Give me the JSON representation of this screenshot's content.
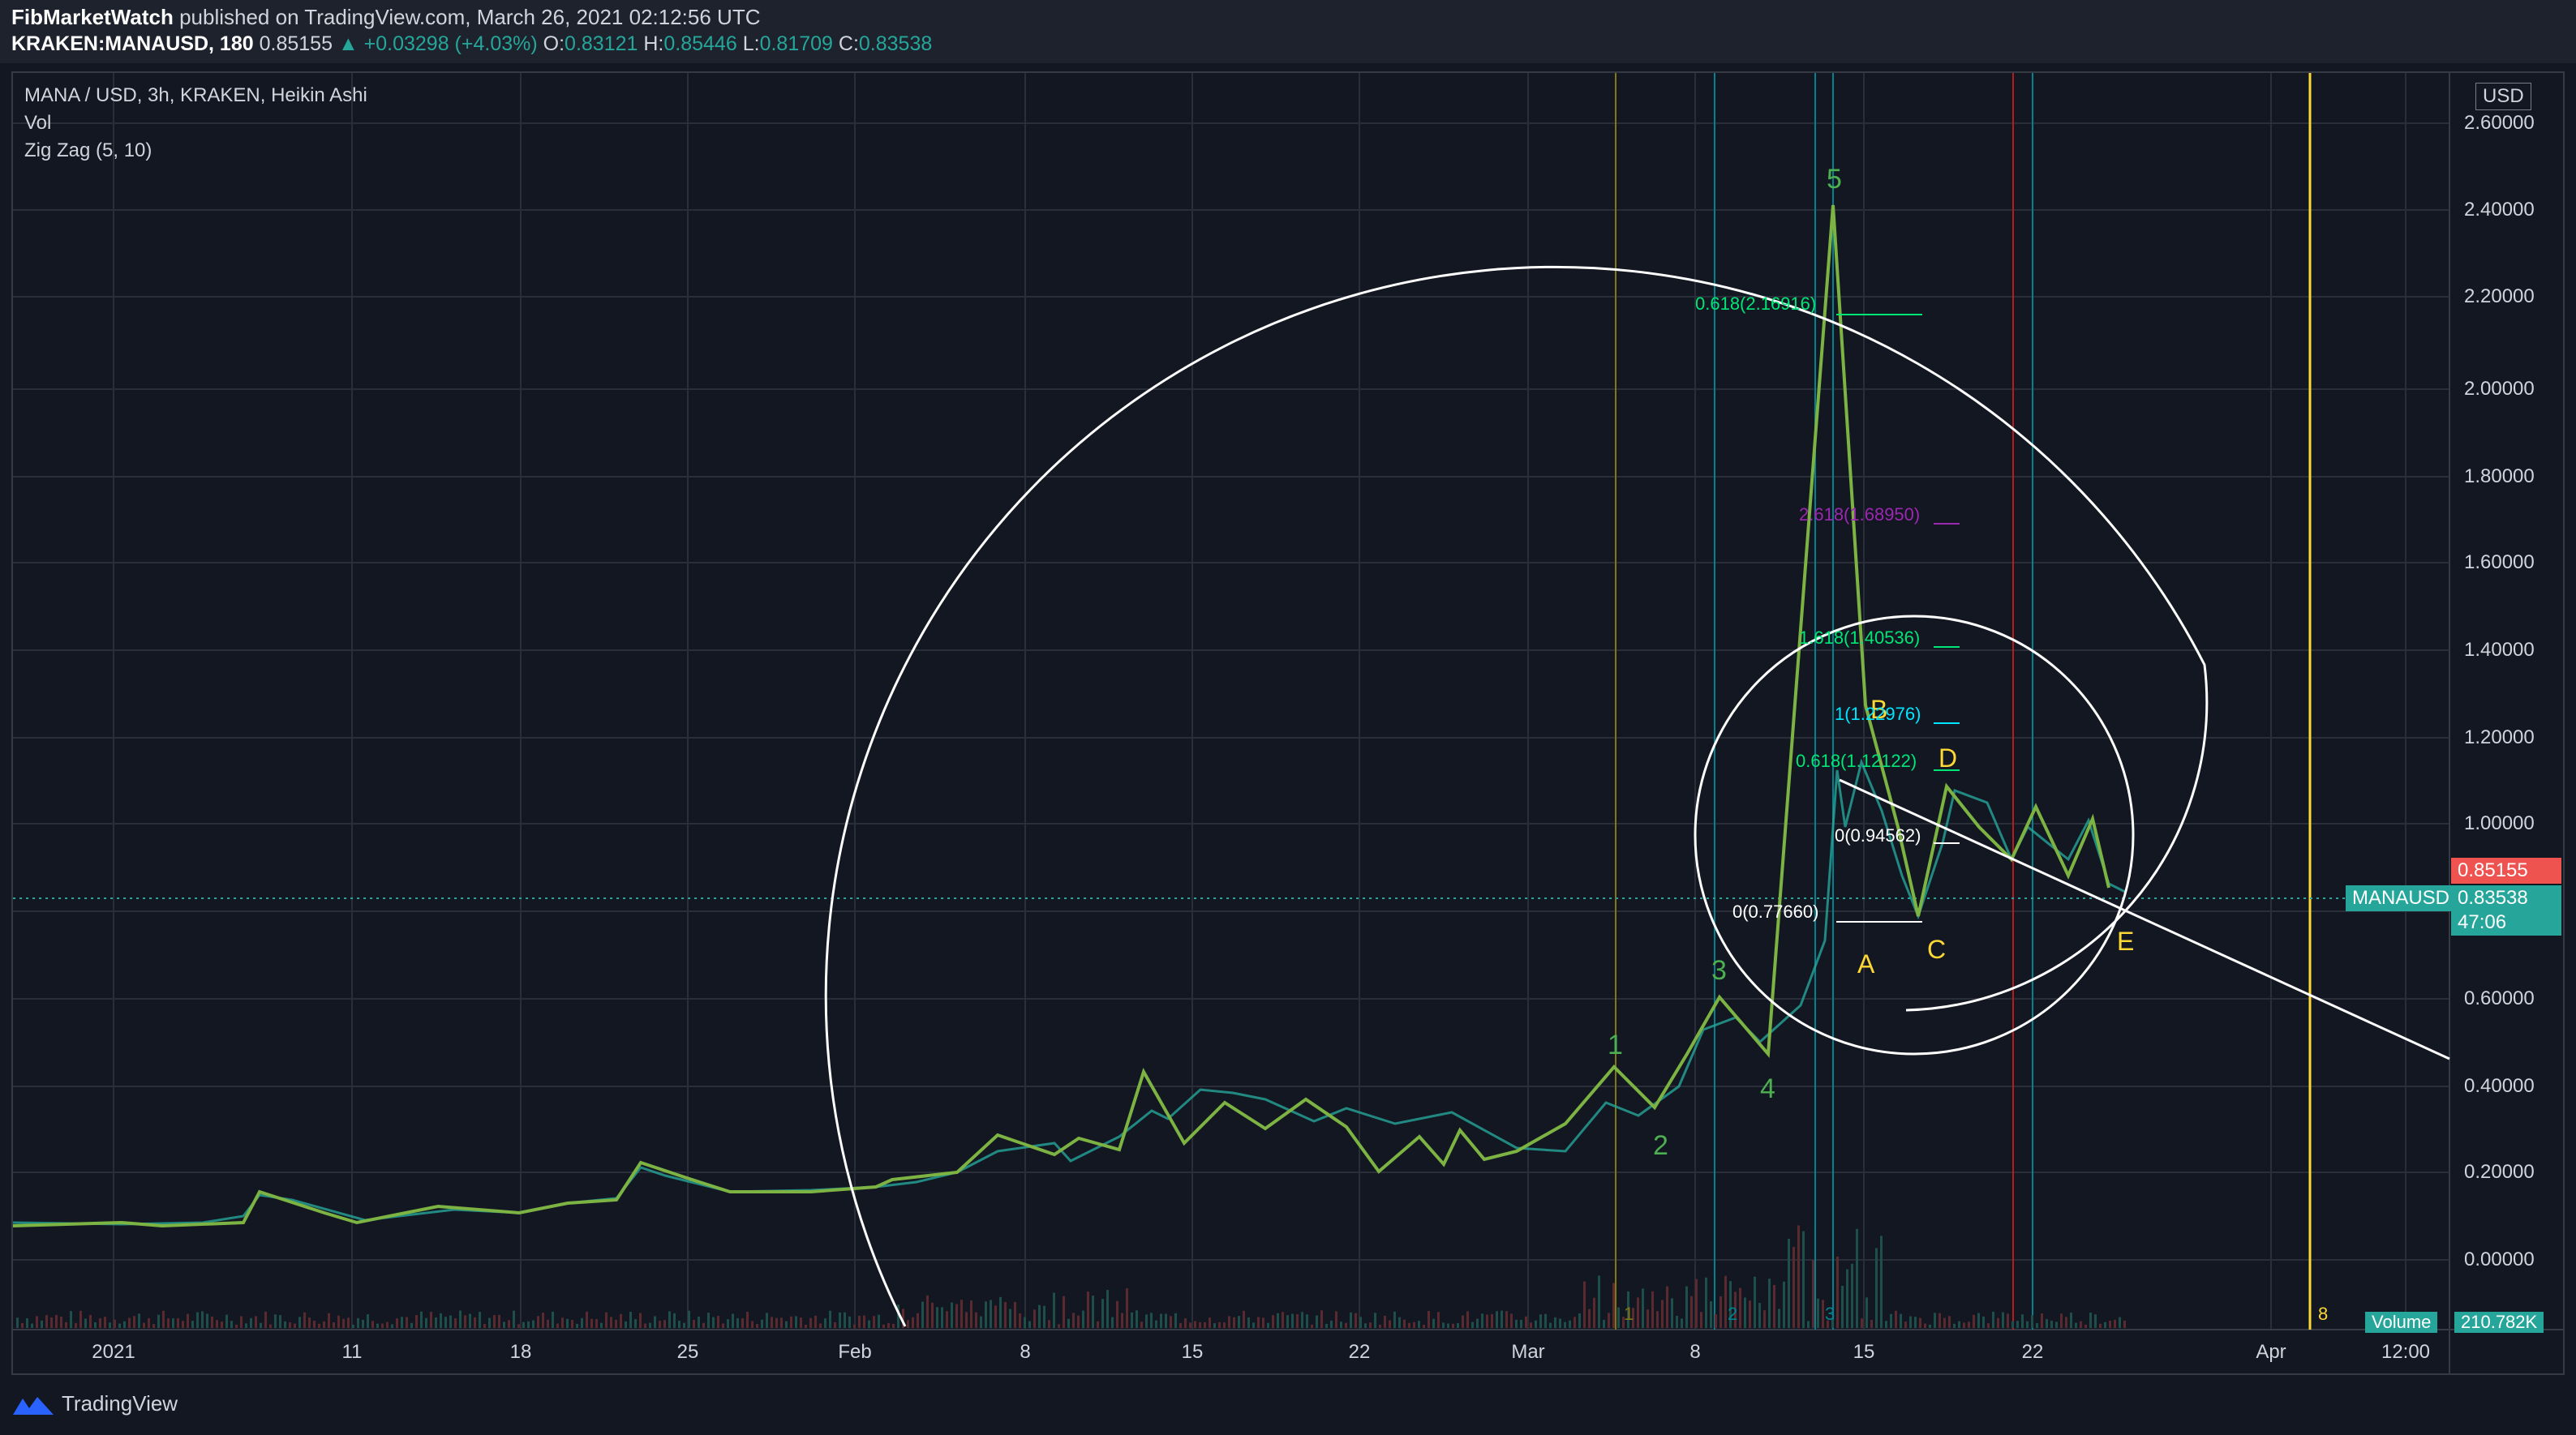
{
  "header": {
    "author": "FibMarketWatch",
    "published_text": "published on TradingView.com, March 26, 2021 02:12:56 UTC"
  },
  "ohlc": {
    "symbol": "KRAKEN:MANAUSD, 180",
    "last": "0.85155",
    "change": "▲ +0.03298 (+4.03%)",
    "o_label": "O:",
    "o": "0.83121",
    "h_label": "H:",
    "h": "0.85446",
    "l_label": "L:",
    "l": "0.81709",
    "c_label": "C:",
    "c": "0.83538"
  },
  "legend": {
    "title": "MANA / USD, 3h, KRAKEN, Heikin Ashi",
    "vol": "Vol",
    "zigzag": "Zig Zag (5, 10)"
  },
  "price_axis": {
    "currency": "USD",
    "labels": [
      "2.60000",
      "2.40000",
      "2.20000",
      "2.00000",
      "1.80000",
      "1.60000",
      "1.40000",
      "1.20000",
      "1.00000",
      "0.80000",
      "0.60000",
      "0.40000",
      "0.20000",
      "0.00000"
    ],
    "last_price_tag": "0.85155",
    "current_tag": "0.83538",
    "countdown": "47:06",
    "symbol_tag": "MANAUSD",
    "volume_tag_label": "Volume",
    "volume_tag_value": "210.782K"
  },
  "time_axis": {
    "labels": [
      "2021",
      "11",
      "18",
      "25",
      "Feb",
      "8",
      "15",
      "22",
      "Mar",
      "8",
      "15",
      "22",
      "Apr",
      "12:00"
    ]
  },
  "annotations": {
    "waves": [
      "1",
      "2",
      "3",
      "4",
      "5"
    ],
    "corrective": [
      "A",
      "B",
      "C",
      "D",
      "E"
    ],
    "fib_0618_top": "0.618(2.16916)",
    "fib_2618": "2.618(1.68950)",
    "fib_1618": "1.618(1.40536)",
    "fib_1": "1(1.22976)",
    "fib_0618_low": "0.618(1.12122)",
    "fib_0_mid": "0(0.94562)",
    "fib_0_low": "0(0.77660)",
    "cycle_marks": [
      "1",
      "2",
      "3",
      "8"
    ]
  },
  "colors": {
    "background": "#131722",
    "panel": "#1e222d",
    "up": "#26a69a",
    "down": "#ef5350",
    "zigzag": "#7cb342",
    "wave_label": "#4caf50",
    "corrective_label": "#fdd835",
    "fib_green": "#00e676",
    "fib_purple": "#9c27b0",
    "fib_cyan": "#00e5ff"
  },
  "footer": {
    "brand": "TradingView"
  }
}
